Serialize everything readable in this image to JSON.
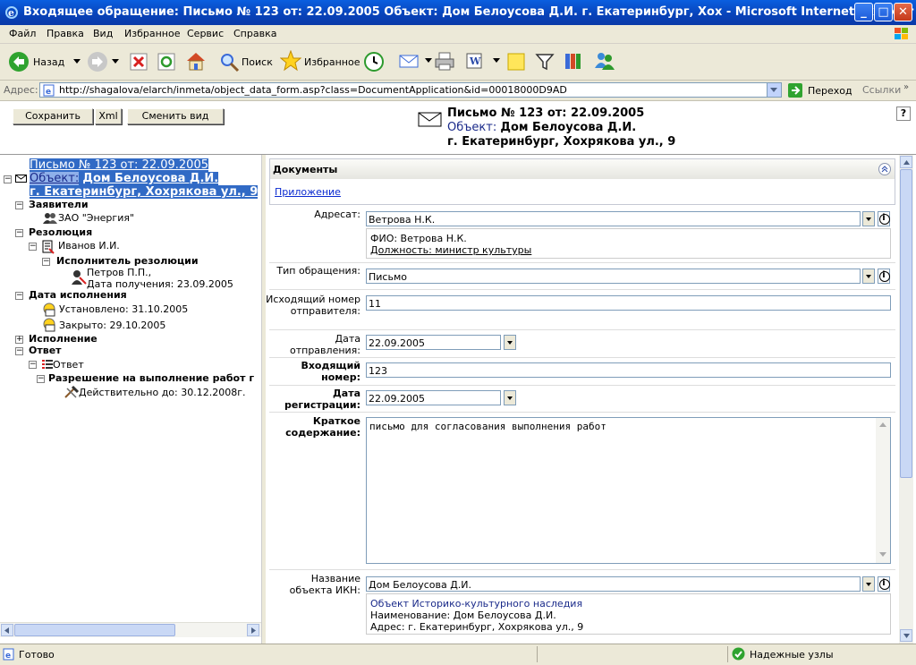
{
  "window": {
    "title": "Входящее обращение: Письмо № 123 от: 22.09.2005 Объект: Дом Белоусова Д.И. г. Екатеринбург, Хох - Microsoft Internet Explorer",
    "minimize": "_",
    "maximize": "□",
    "close": "✕"
  },
  "menu": [
    "Файл",
    "Правка",
    "Вид",
    "Избранное",
    "Сервис",
    "Справка"
  ],
  "toolbar": {
    "back": "Назад",
    "search": "Поиск",
    "favorites": "Избранное"
  },
  "address": {
    "label": "Адрес:",
    "url": "http://shagalova/elarch/inmeta/object_data_form.asp?class=DocumentApplication&id=00018000D9AD",
    "go": "Переход",
    "links": "Ссылки"
  },
  "form": {
    "save": "Сохранить",
    "xml": "Xml",
    "change_view": "Сменить вид",
    "header_line1": "Письмо № 123 от: 22.09.2005",
    "header_obj_label": "Объект:",
    "header_obj_value": "Дом Белоусова Д.И.",
    "header_line3": "г. Екатеринбург, Хохрякова ул., 9",
    "help": "?"
  },
  "tree": {
    "root_line1": "Письмо № 123 от: 22.09.2005",
    "root_obj_label": "Объект:",
    "root_obj_value": "Дом Белоусова Д.И.",
    "root_line3": "г. Екатеринбург, Хохрякова ул., 9",
    "applicants": "Заявители",
    "applicant1": "ЗАО \"Энергия\"",
    "resolution": "Резолюция",
    "resolution_person": "Иванов И.И.",
    "executor": "Исполнитель резолюции",
    "executor_name": "Петров П.П.,",
    "executor_date": "Дата получения: 23.09.2005",
    "exec_date": "Дата исполнения",
    "established": "Установлено: 31.10.2005",
    "closed": "Закрыто: 29.10.2005",
    "execution": "Исполнение",
    "answer": "Ответ",
    "answer_item": "Ответ",
    "permit": "Разрешение на выполнение работ г",
    "valid_until": "Действительно до: 30.12.2008г."
  },
  "documents": {
    "title": "Документы",
    "link": "Приложение"
  },
  "fields": {
    "addressee_label": "Адресат:",
    "addressee_value": "Ветрова Н.К.",
    "addressee_fio": "ФИО: Ветрова Н.К.",
    "addressee_pos": "Должность: министр культуры",
    "type_label": "Тип обращения:",
    "type_value": "Письмо",
    "outnum_label": "Исходящий номер отправителя:",
    "outnum_value": "11",
    "sentdate_label": "Дата отправления:",
    "sentdate_value": "22.09.2005",
    "innum_label": "Входящий номер:",
    "innum_value": "123",
    "regdate_label": "Дата регистрации:",
    "regdate_value": "22.09.2005",
    "summary_label": "Краткое содержание:",
    "summary_value": "письмо для согласования выполнения работ",
    "object_label": "Название объекта ИКН:",
    "object_value": "Дом Белоусова Д.И.",
    "object_info1": "Объект Историко-культурного наследия",
    "object_info2": "Наименование: Дом Белоусова Д.И.",
    "object_info3": "Адрес: г. Екатеринбург, Хохрякова ул., 9"
  },
  "status": {
    "ready": "Готово",
    "zone": "Надежные узлы"
  }
}
